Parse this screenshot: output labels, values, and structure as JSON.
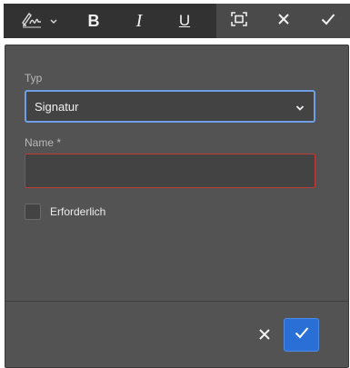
{
  "toolbar": {
    "signature_tool_icon": "signature-pen-icon",
    "dropdown_icon": "chevron-down-icon",
    "bold_label": "B",
    "italic_label": "I",
    "underline_label": "U",
    "fit_icon": "fit-frame-icon",
    "close_icon": "close-icon",
    "confirm_icon": "checkmark-icon"
  },
  "form": {
    "type_label": "Typ",
    "type_value": "Signatur",
    "name_label": "Name *",
    "name_value": "",
    "required_label": "Erforderlich",
    "required_checked": false
  },
  "footer": {
    "cancel_icon": "close-icon",
    "ok_icon": "checkmark-icon"
  },
  "colors": {
    "toolbar_bg": "#323232",
    "panel_bg": "#535353",
    "accent": "#2a6fd6",
    "focus_border": "#6e9fe6",
    "error_border": "#c03a3a"
  }
}
